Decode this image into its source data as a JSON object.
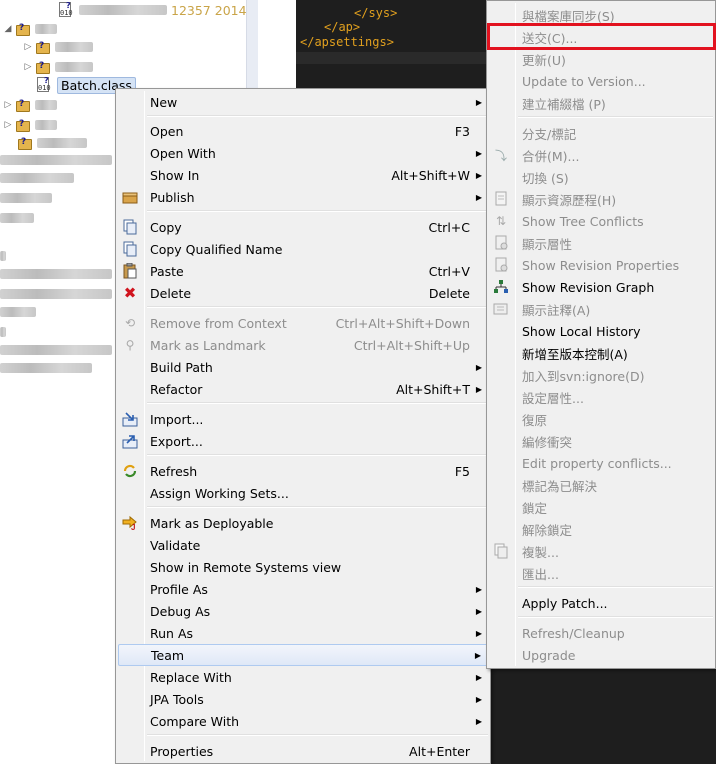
{
  "tree": {
    "class_meta_number": "12357",
    "class_meta_year": "2014",
    "selected_node": "Batch.class"
  },
  "editor": {
    "lines": [
      "</sys>",
      "</ap>",
      "</apsettings>"
    ]
  },
  "context_menu": {
    "items": [
      {
        "label": "New",
        "shortcut": "",
        "submenu": true,
        "disabled": false,
        "icon": ""
      },
      {
        "label": "Open",
        "shortcut": "F3",
        "submenu": false,
        "disabled": false,
        "icon": ""
      },
      {
        "label": "Open With",
        "shortcut": "",
        "submenu": true,
        "disabled": false,
        "icon": ""
      },
      {
        "label": "Show In",
        "shortcut": "Alt+Shift+W",
        "submenu": true,
        "disabled": false,
        "icon": ""
      },
      {
        "label": "Publish",
        "shortcut": "",
        "submenu": true,
        "disabled": false,
        "icon": "publish-icon"
      },
      {
        "label": "Copy",
        "shortcut": "Ctrl+C",
        "submenu": false,
        "disabled": false,
        "icon": "copy-icon"
      },
      {
        "label": "Copy Qualified Name",
        "shortcut": "",
        "submenu": false,
        "disabled": false,
        "icon": "copy-qualified-icon"
      },
      {
        "label": "Paste",
        "shortcut": "Ctrl+V",
        "submenu": false,
        "disabled": false,
        "icon": "paste-icon"
      },
      {
        "label": "Delete",
        "shortcut": "Delete",
        "submenu": false,
        "disabled": false,
        "icon": "delete-icon"
      },
      {
        "label": "Remove from Context",
        "shortcut": "Ctrl+Alt+Shift+Down",
        "submenu": false,
        "disabled": true,
        "icon": "remove-context-icon"
      },
      {
        "label": "Mark as Landmark",
        "shortcut": "Ctrl+Alt+Shift+Up",
        "submenu": false,
        "disabled": true,
        "icon": "landmark-icon"
      },
      {
        "label": "Build Path",
        "shortcut": "",
        "submenu": true,
        "disabled": false,
        "icon": ""
      },
      {
        "label": "Refactor",
        "shortcut": "Alt+Shift+T",
        "submenu": true,
        "disabled": false,
        "icon": ""
      },
      {
        "label": "Import...",
        "shortcut": "",
        "submenu": false,
        "disabled": false,
        "icon": "import-icon"
      },
      {
        "label": "Export...",
        "shortcut": "",
        "submenu": false,
        "disabled": false,
        "icon": "export-icon"
      },
      {
        "label": "Refresh",
        "shortcut": "F5",
        "submenu": false,
        "disabled": false,
        "icon": "refresh-icon"
      },
      {
        "label": "Assign Working Sets...",
        "shortcut": "",
        "submenu": false,
        "disabled": false,
        "icon": ""
      },
      {
        "label": "Mark as Deployable",
        "shortcut": "",
        "submenu": false,
        "disabled": false,
        "icon": "deployable-icon"
      },
      {
        "label": "Validate",
        "shortcut": "",
        "submenu": false,
        "disabled": false,
        "icon": ""
      },
      {
        "label": "Show in Remote Systems view",
        "shortcut": "",
        "submenu": false,
        "disabled": false,
        "icon": ""
      },
      {
        "label": "Profile As",
        "shortcut": "",
        "submenu": true,
        "disabled": false,
        "icon": ""
      },
      {
        "label": "Debug As",
        "shortcut": "",
        "submenu": true,
        "disabled": false,
        "icon": ""
      },
      {
        "label": "Run As",
        "shortcut": "",
        "submenu": true,
        "disabled": false,
        "icon": ""
      },
      {
        "label": "Team",
        "shortcut": "",
        "submenu": true,
        "disabled": false,
        "icon": ""
      },
      {
        "label": "Replace With",
        "shortcut": "",
        "submenu": true,
        "disabled": false,
        "icon": ""
      },
      {
        "label": "JPA Tools",
        "shortcut": "",
        "submenu": true,
        "disabled": false,
        "icon": ""
      },
      {
        "label": "Compare With",
        "shortcut": "",
        "submenu": true,
        "disabled": false,
        "icon": ""
      },
      {
        "label": "Properties",
        "shortcut": "Alt+Enter",
        "submenu": false,
        "disabled": false,
        "icon": ""
      }
    ],
    "highlighted_item": "Team"
  },
  "team_submenu": {
    "items": [
      {
        "label": "與檔案庫同步(S)",
        "disabled": true,
        "icon": ""
      },
      {
        "label": "送交(C)...",
        "disabled": true,
        "icon": ""
      },
      {
        "label": "更新(U)",
        "disabled": true,
        "icon": ""
      },
      {
        "label": "Update to Version...",
        "disabled": true,
        "icon": ""
      },
      {
        "label": "建立補綴檔 (P)",
        "disabled": true,
        "icon": ""
      },
      {
        "label": "分支/標記",
        "disabled": true,
        "icon": ""
      },
      {
        "label": "合併(M)...",
        "disabled": true,
        "icon": "merge-icon"
      },
      {
        "label": "切換 (S)",
        "disabled": true,
        "icon": ""
      },
      {
        "label": "顯示資源歷程(H)",
        "disabled": true,
        "icon": "history-icon"
      },
      {
        "label": "Show Tree Conflicts",
        "disabled": true,
        "icon": "tree-conflicts-icon"
      },
      {
        "label": "顯示層性",
        "disabled": true,
        "icon": "properties-icon"
      },
      {
        "label": "Show Revision Properties",
        "disabled": true,
        "icon": "revision-properties-icon"
      },
      {
        "label": "Show Revision Graph",
        "disabled": false,
        "icon": "revision-graph-icon"
      },
      {
        "label": "顯示註釋(A)",
        "disabled": true,
        "icon": "annotate-icon"
      },
      {
        "label": "Show Local History",
        "disabled": false,
        "icon": ""
      },
      {
        "label": "新增至版本控制(A)",
        "disabled": false,
        "icon": ""
      },
      {
        "label": "加入到svn:ignore(D)",
        "disabled": true,
        "icon": ""
      },
      {
        "label": "設定層性...",
        "disabled": true,
        "icon": ""
      },
      {
        "label": "復原",
        "disabled": true,
        "icon": ""
      },
      {
        "label": "編修衝突",
        "disabled": true,
        "icon": ""
      },
      {
        "label": "Edit property conflicts...",
        "disabled": true,
        "icon": ""
      },
      {
        "label": "標記為已解決",
        "disabled": true,
        "icon": ""
      },
      {
        "label": "鎖定",
        "disabled": true,
        "icon": ""
      },
      {
        "label": "解除鎖定",
        "disabled": true,
        "icon": ""
      },
      {
        "label": "複製...",
        "disabled": true,
        "icon": "copy-icon"
      },
      {
        "label": "匯出...",
        "disabled": true,
        "icon": ""
      },
      {
        "label": "Apply Patch...",
        "disabled": false,
        "icon": ""
      },
      {
        "label": "Refresh/Cleanup",
        "disabled": true,
        "icon": ""
      },
      {
        "label": "Upgrade",
        "disabled": true,
        "icon": ""
      }
    ],
    "focused_item": "送交(C)...",
    "focus_color": "#e2121f"
  }
}
